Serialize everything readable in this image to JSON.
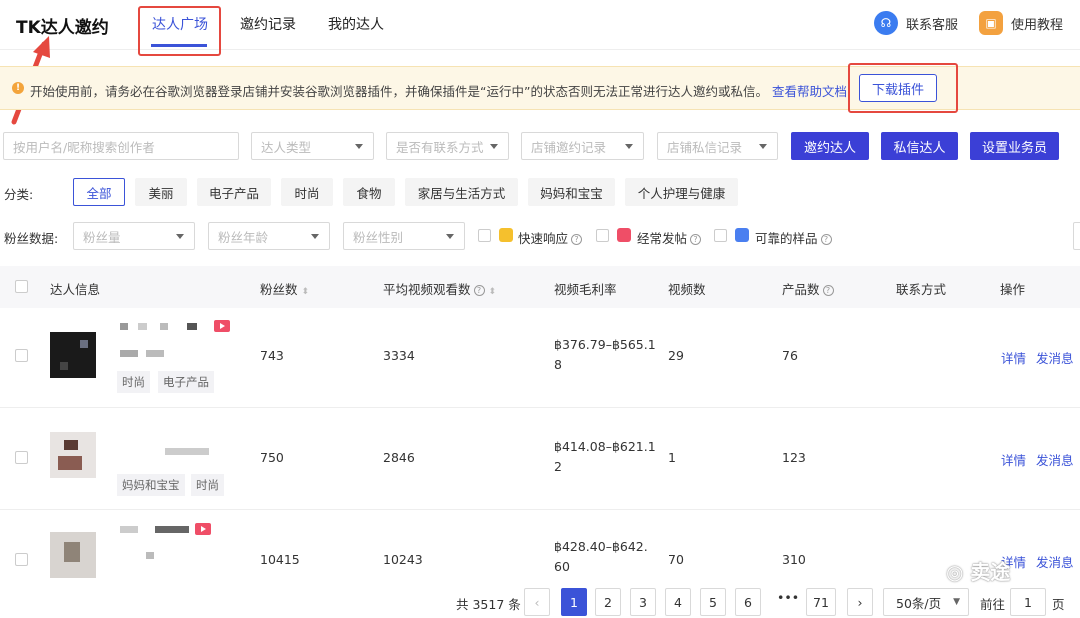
{
  "header": {
    "app_title": "TK达人邀约",
    "tabs": [
      {
        "label": "达人广场",
        "active": true
      },
      {
        "label": "邀约记录",
        "active": false
      },
      {
        "label": "我的达人",
        "active": false
      }
    ],
    "support_label": "联系客服",
    "tutorial_label": "使用教程"
  },
  "notice": {
    "text": "开始使用前，请务必在谷歌浏览器登录店铺并安装谷歌浏览器插件，并确保插件是“运行中”的状态否则无法正常进行达人邀约或私信。",
    "help_link": "查看帮助文档",
    "download_button": "下载插件"
  },
  "filters": {
    "search_placeholder": "按用户名/昵称搜索创作者",
    "selects": [
      "达人类型",
      "是否有联系方式",
      "店铺邀约记录",
      "店铺私信记录"
    ],
    "buttons": [
      "邀约达人",
      "私信达人",
      "设置业务员"
    ],
    "category_label": "分类:",
    "categories": [
      "全部",
      "美丽",
      "电子产品",
      "时尚",
      "食物",
      "家居与生活方式",
      "妈妈和宝宝",
      "个人护理与健康"
    ],
    "fans_label": "粉丝数据:",
    "fans_selects": [
      "粉丝量",
      "粉丝年龄",
      "粉丝性别"
    ],
    "flags": [
      "快速响应",
      "经常发帖",
      "可靠的样品"
    ]
  },
  "table": {
    "columns": [
      "达人信息",
      "粉丝数",
      "平均视频观看数",
      "视频毛利率",
      "视频数",
      "产品数",
      "联系方式",
      "操作"
    ],
    "rows": [
      {
        "tags": [
          "时尚",
          "电子产品"
        ],
        "fans": "743",
        "avg_views": "3334",
        "margin_line1": "฿376.79–฿565.1",
        "margin_line2": "8",
        "videos": "29",
        "products": "76"
      },
      {
        "tags": [
          "妈妈和宝宝",
          "时尚"
        ],
        "fans": "750",
        "avg_views": "2846",
        "margin_line1": "฿414.08–฿621.1",
        "margin_line2": "2",
        "videos": "1",
        "products": "123"
      },
      {
        "tags": [],
        "fans": "10415",
        "avg_views": "10243",
        "margin_line1": "฿428.40–฿642.",
        "margin_line2": "60",
        "videos": "70",
        "products": "310"
      }
    ],
    "actions": {
      "detail": "详情",
      "message": "发消息"
    }
  },
  "pagination": {
    "total_text": "共 3517 条",
    "pages": [
      "1",
      "2",
      "3",
      "4",
      "5",
      "6",
      "•••",
      "71"
    ],
    "current": "1",
    "page_size": "50条/页",
    "goto_label": "前往",
    "goto_value": "1",
    "page_unit": "页"
  },
  "watermark": "卖途",
  "colors": {
    "accent": "#3b53d8",
    "primary_button": "#3b3fd6",
    "annotation_red": "#e5483f"
  }
}
